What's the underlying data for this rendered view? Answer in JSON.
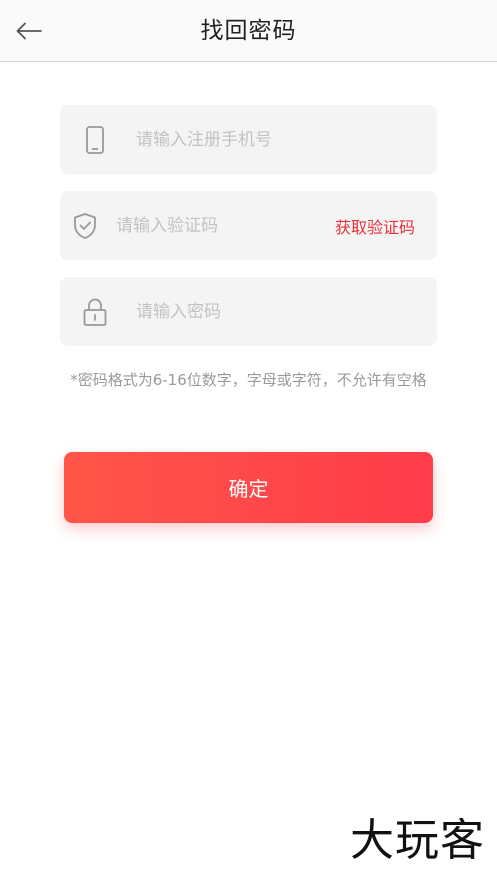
{
  "header": {
    "title": "找回密码"
  },
  "form": {
    "phone": {
      "placeholder": "请输入注册手机号",
      "icon": "phone-icon"
    },
    "code": {
      "placeholder": "请输入验证码",
      "icon": "shield-check-icon",
      "get_code_label": "获取验证码"
    },
    "password": {
      "placeholder": "请输入密码",
      "icon": "lock-icon"
    },
    "hint": "*密码格式为6-16位数字，字母或字符，不允许有空格",
    "confirm_label": "确定"
  },
  "watermark": "大玩客",
  "colors": {
    "accent": "#e8323c",
    "button_gradient_start": "#ff5548",
    "button_gradient_end": "#ff3c4b",
    "field_bg": "#f4f4f4",
    "hint_text": "#9a9a9a"
  }
}
